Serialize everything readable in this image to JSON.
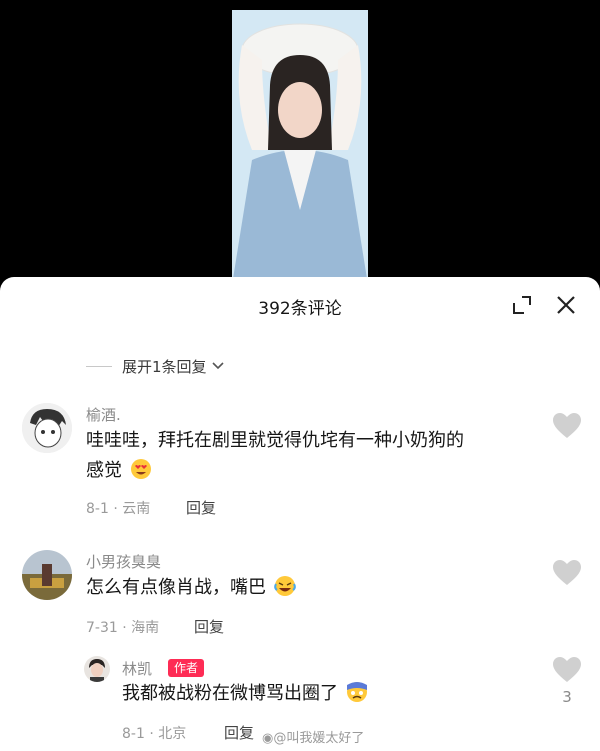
{
  "sheet": {
    "title": "392条评论",
    "expand_replies": "展开1条回复"
  },
  "comments": [
    {
      "username": "榆酒.",
      "text_line1": "哇哇哇，拜托在剧里就觉得仇垞有一种小奶狗的",
      "text_line2": "感觉",
      "date": "8-1",
      "location": "云南",
      "reply_label": "回复",
      "emoji": "heart-eyes-emoji"
    },
    {
      "username": "小男孩臭臭",
      "text": "怎么有点像肖战，嘴巴",
      "date": "7-31",
      "location": "海南",
      "reply_label": "回复",
      "emoji": "laughing-tears-emoji"
    },
    {
      "username": "林凯",
      "badge": "作者",
      "text": "我都被战粉在微博骂出圈了",
      "date": "8-1",
      "location": "北京",
      "reply_label": "回复",
      "like_count": "3",
      "emoji": "cold-sweat-emoji"
    }
  ],
  "watermark": "@叫我媛太好了",
  "colors": {
    "accent": "#fe2c55",
    "like_gray": "#d0d0d0",
    "meta_gray": "#9a9a9a"
  }
}
